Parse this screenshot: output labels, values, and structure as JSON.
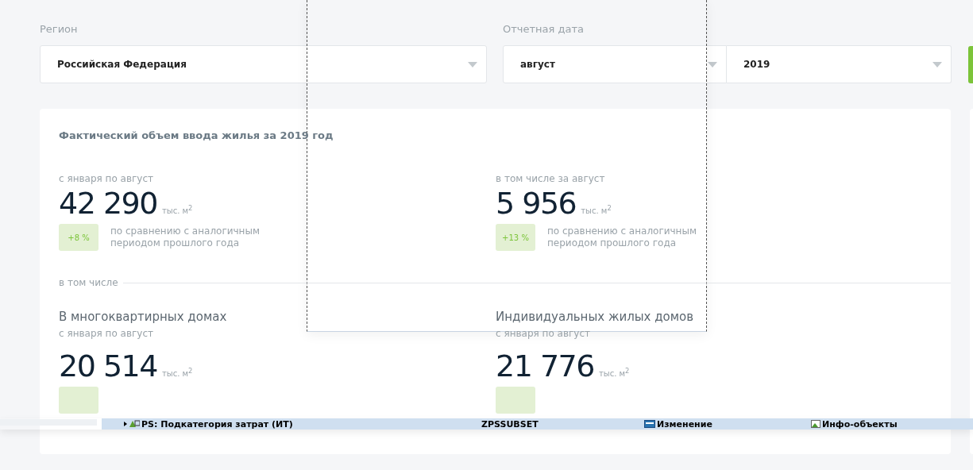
{
  "filters": {
    "region": {
      "label": "Регион",
      "value": "Российская Федерация"
    },
    "date": {
      "label": "Отчетная дата",
      "month": "август",
      "year": "2019"
    }
  },
  "card": {
    "title": "Фактический объем ввода жилья за 2019 год",
    "stats": [
      {
        "period": "с января по август",
        "value": "42 290",
        "unit": "тыс. м$^{2}$",
        "change": "+8 %",
        "note": "по сравнению с аналогичным периодом прошлого года"
      },
      {
        "period": "в том числе за август",
        "value": "5 956",
        "unit": "тыс. м$^{2}$",
        "change": "+13 %",
        "note": "по сравнению с аналогичным периодом прошлого года"
      }
    ],
    "subtotal_label": "в том числе",
    "groups": [
      {
        "heading": "В многоквартирных домах",
        "period": "с января по август",
        "value": "20 514",
        "unit": "тыс. м$^{2}$"
      },
      {
        "heading": "Индивидуальных жилых домов",
        "period": "с января по август",
        "value": "21 776",
        "unit": "тыс. м$^{2}$"
      }
    ]
  },
  "overlay_strip": {
    "items": [
      {
        "kind": "tree",
        "text": "PS: Подкатегория затрат (ИТ)"
      },
      {
        "kind": "plain",
        "text": "ZPSSUBSET"
      },
      {
        "kind": "action",
        "text": "Изменение"
      },
      {
        "kind": "info",
        "text": "Инфо-объекты"
      }
    ]
  }
}
